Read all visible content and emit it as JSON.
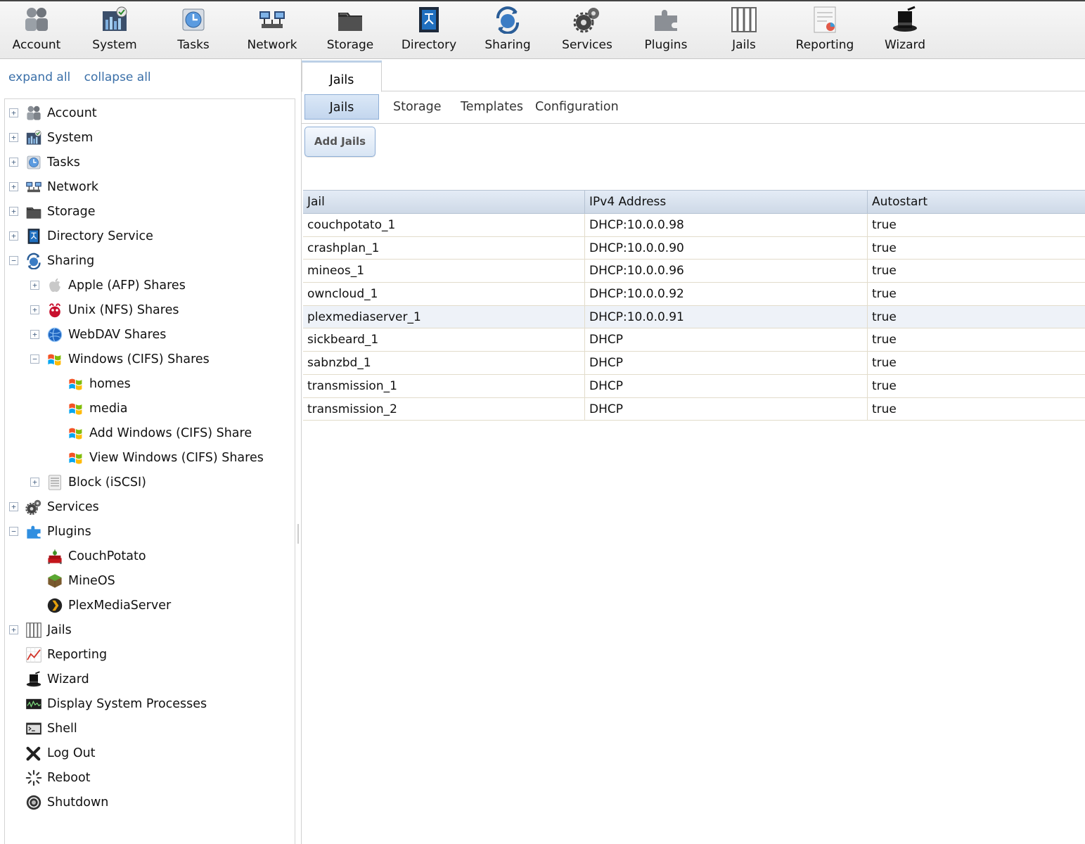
{
  "toolbar": {
    "items": [
      {
        "label": "Account",
        "icon": "account-icon"
      },
      {
        "label": "System",
        "icon": "system-icon"
      },
      {
        "label": "Tasks",
        "icon": "tasks-icon"
      },
      {
        "label": "Network",
        "icon": "network-icon"
      },
      {
        "label": "Storage",
        "icon": "storage-icon"
      },
      {
        "label": "Directory",
        "icon": "directory-icon"
      },
      {
        "label": "Sharing",
        "icon": "sharing-icon"
      },
      {
        "label": "Services",
        "icon": "services-icon"
      },
      {
        "label": "Plugins",
        "icon": "plugins-icon"
      },
      {
        "label": "Jails",
        "icon": "jails-icon"
      },
      {
        "label": "Reporting",
        "icon": "reporting-icon"
      },
      {
        "label": "Wizard",
        "icon": "wizard-icon"
      }
    ]
  },
  "tree_links": {
    "expand_all": "expand all",
    "collapse_all": "collapse all"
  },
  "tree": {
    "items": [
      {
        "label": "Account",
        "icon": "account-icon",
        "toggle": "+"
      },
      {
        "label": "System",
        "icon": "system-icon",
        "toggle": "+"
      },
      {
        "label": "Tasks",
        "icon": "tasks-icon",
        "toggle": "+"
      },
      {
        "label": "Network",
        "icon": "network-icon",
        "toggle": "+"
      },
      {
        "label": "Storage",
        "icon": "storage-icon",
        "toggle": "+"
      },
      {
        "label": "Directory Service",
        "icon": "directory-icon",
        "toggle": "+"
      },
      {
        "label": "Sharing",
        "icon": "sharing-icon",
        "toggle": "−"
      },
      {
        "label": "Apple (AFP) Shares",
        "icon": "apple-icon",
        "toggle": "+"
      },
      {
        "label": "Unix (NFS) Shares",
        "icon": "unix-icon",
        "toggle": "+"
      },
      {
        "label": "WebDAV Shares",
        "icon": "webdav-icon",
        "toggle": "+"
      },
      {
        "label": "Windows (CIFS) Shares",
        "icon": "windows-icon",
        "toggle": "−"
      },
      {
        "label": "homes",
        "icon": "windows-icon",
        "toggle": ""
      },
      {
        "label": "media",
        "icon": "windows-icon",
        "toggle": ""
      },
      {
        "label": "Add Windows (CIFS) Share",
        "icon": "windows-add-icon",
        "toggle": ""
      },
      {
        "label": "View Windows (CIFS) Shares",
        "icon": "windows-view-icon",
        "toggle": ""
      },
      {
        "label": "Block (iSCSI)",
        "icon": "block-icon",
        "toggle": "+"
      },
      {
        "label": "Services",
        "icon": "services-icon",
        "toggle": "+"
      },
      {
        "label": "Plugins",
        "icon": "plugins-icon",
        "toggle": "−"
      },
      {
        "label": "CouchPotato",
        "icon": "couchpotato-icon",
        "toggle": ""
      },
      {
        "label": "MineOS",
        "icon": "mineos-icon",
        "toggle": ""
      },
      {
        "label": "PlexMediaServer",
        "icon": "plex-icon",
        "toggle": ""
      },
      {
        "label": "Jails",
        "icon": "jails-icon",
        "toggle": "+"
      },
      {
        "label": "Reporting",
        "icon": "reporting-icon",
        "toggle": ""
      },
      {
        "label": "Wizard",
        "icon": "wizard-icon",
        "toggle": ""
      },
      {
        "label": "Display System Processes",
        "icon": "processes-icon",
        "toggle": ""
      },
      {
        "label": "Shell",
        "icon": "shell-icon",
        "toggle": ""
      },
      {
        "label": "Log Out",
        "icon": "logout-icon",
        "toggle": ""
      },
      {
        "label": "Reboot",
        "icon": "reboot-icon",
        "toggle": ""
      },
      {
        "label": "Shutdown",
        "icon": "shutdown-icon",
        "toggle": ""
      }
    ]
  },
  "main": {
    "outer_tab": "Jails",
    "inner_tabs": [
      "Jails",
      "Storage",
      "Templates",
      "Configuration"
    ],
    "add_button": "Add Jails",
    "grid": {
      "columns": [
        "Jail",
        "IPv4 Address",
        "Autostart"
      ],
      "rows": [
        [
          "couchpotato_1",
          "DHCP:10.0.0.98",
          "true"
        ],
        [
          "crashplan_1",
          "DHCP:10.0.0.90",
          "true"
        ],
        [
          "mineos_1",
          "DHCP:10.0.0.96",
          "true"
        ],
        [
          "owncloud_1",
          "DHCP:10.0.0.92",
          "true"
        ],
        [
          "plexmediaserver_1",
          "DHCP:10.0.0.91",
          "true"
        ],
        [
          "sickbeard_1",
          "DHCP",
          "true"
        ],
        [
          "sabnzbd_1",
          "DHCP",
          "true"
        ],
        [
          "transmission_1",
          "DHCP",
          "true"
        ],
        [
          "transmission_2",
          "DHCP",
          "true"
        ]
      ],
      "selected_row": 4
    }
  },
  "colors": {
    "accent": "#3a6fa8",
    "tab_active": "#c3d6ee",
    "grid_head": "#ced9e7"
  }
}
